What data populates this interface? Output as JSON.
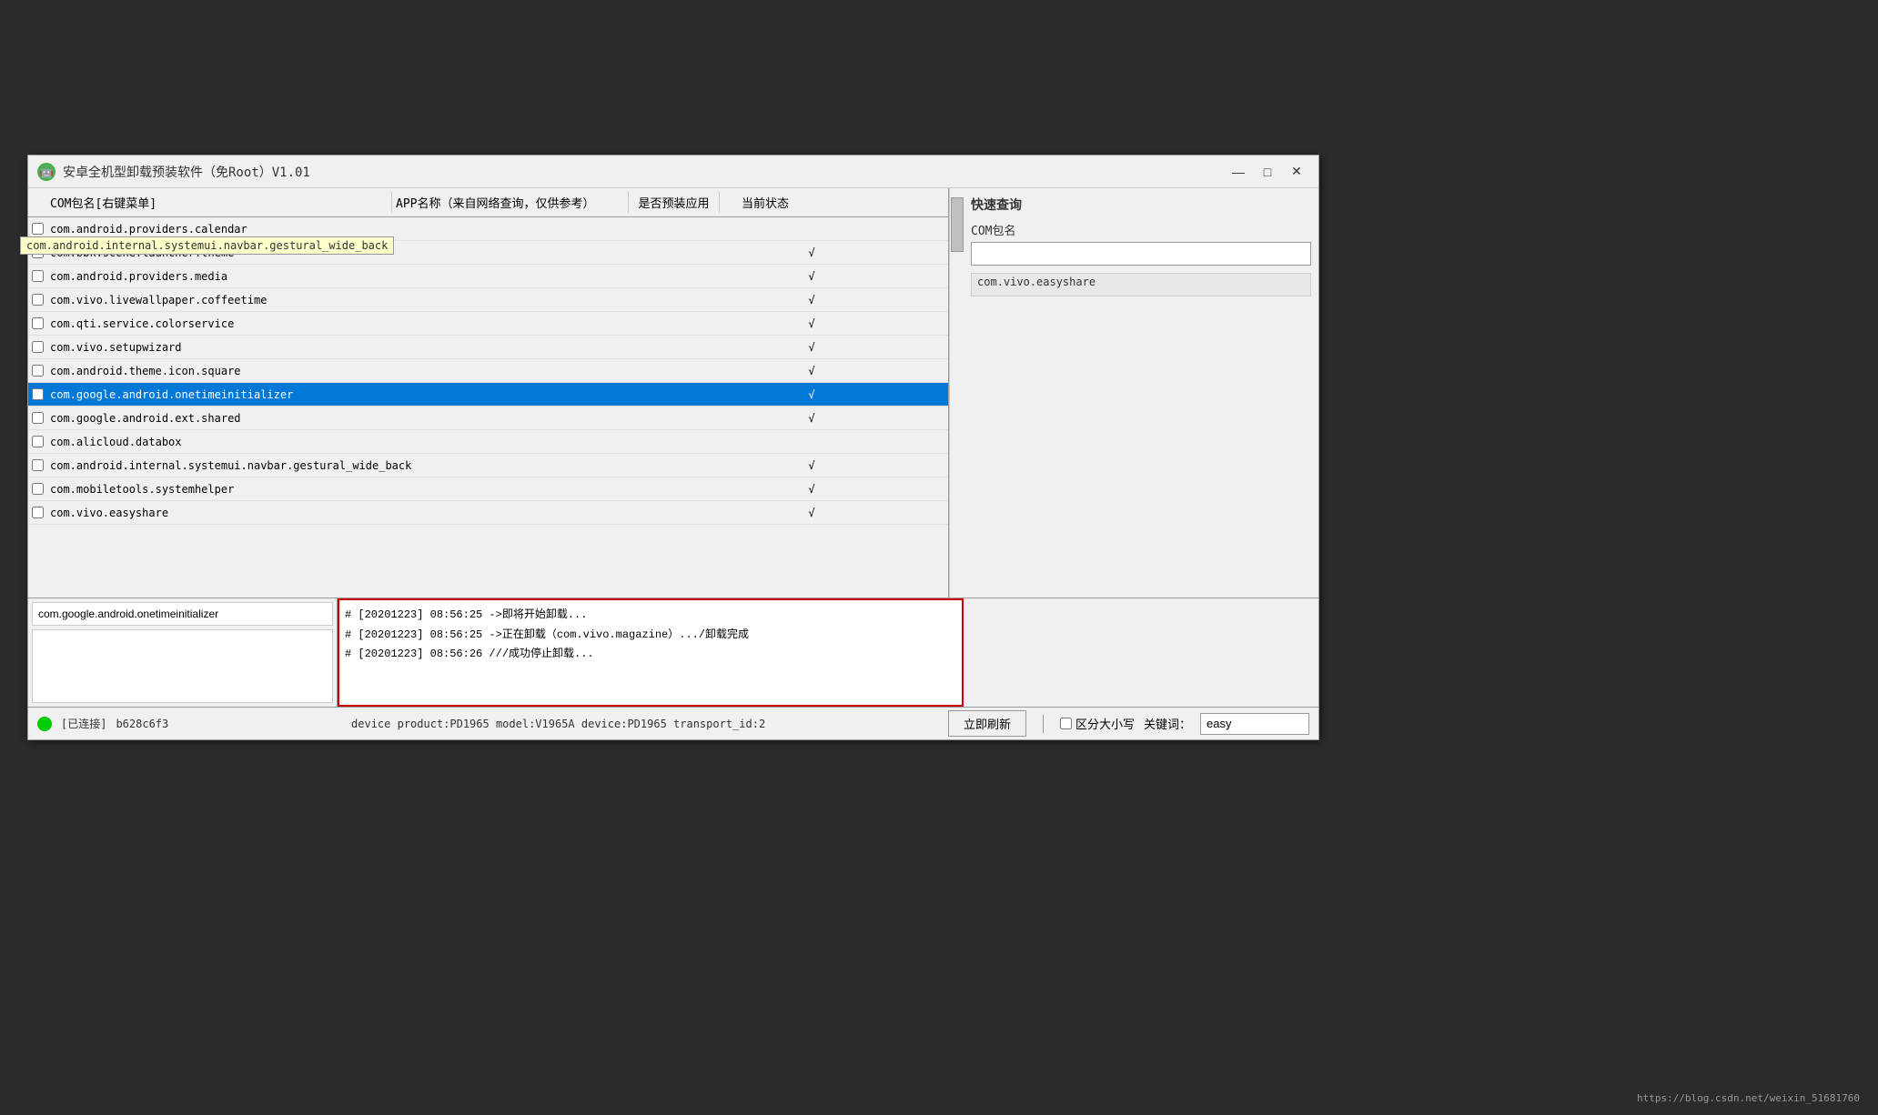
{
  "window": {
    "title": "安卓全机型卸载预装软件（免Root）V1.01",
    "icon": "🤖",
    "minimize_label": "—",
    "maximize_label": "□",
    "close_label": "✕"
  },
  "table": {
    "headers": {
      "package": "COM包名[右键菜单]",
      "appname": "APP名称（来自网络查询，仅供参考）",
      "preinstall": "是否预装应用",
      "status": "当前状态"
    },
    "rows": [
      {
        "pkg": "com.android.providers.calendar",
        "name": "",
        "preinstall": "",
        "status": ""
      },
      {
        "pkg": "com.bbk.scene.launcher.theme",
        "name": "",
        "preinstall": "√",
        "status": ""
      },
      {
        "pkg": "com.android.providers.media",
        "name": "",
        "preinstall": "√",
        "status": ""
      },
      {
        "pkg": "com.vivo.livewallpaper.coffeetime",
        "name": "",
        "preinstall": "√",
        "status": ""
      },
      {
        "pkg": "com.qti.service.colorservice",
        "name": "",
        "preinstall": "√",
        "status": ""
      },
      {
        "pkg": "com.vivo.setupwizard",
        "name": "",
        "preinstall": "√",
        "status": ""
      },
      {
        "pkg": "com.android.theme.icon.square",
        "name": "",
        "preinstall": "√",
        "status": ""
      },
      {
        "pkg": "com.google.android.onetimeinitializer",
        "name": "",
        "preinstall": "√",
        "status": "",
        "selected": true
      },
      {
        "pkg": "com.google.android.ext.shared",
        "name": "",
        "preinstall": "√",
        "status": ""
      },
      {
        "pkg": "com.alicloud.databox",
        "name": "",
        "preinstall": "",
        "status": ""
      },
      {
        "pkg": "com.android.internal.systemui.navbar.gestural_wide_back",
        "name": "",
        "preinstall": "√",
        "status": ""
      },
      {
        "pkg": "com.mobiletools.systemhelper",
        "name": "",
        "preinstall": "√",
        "status": ""
      },
      {
        "pkg": "com.vivo.easyshare",
        "name": "",
        "preinstall": "√",
        "status": ""
      }
    ]
  },
  "quick_search": {
    "title": "快速查询",
    "package_label": "COM包名",
    "result_value": "com.vivo.easyshare"
  },
  "bottom": {
    "selected_pkg": "com.google.android.onetimeinitializer",
    "log_lines": [
      "# [20201223] 08:56:25 ->即将开始卸载...",
      "# [20201223] 08:56:25 ->正在卸载（com.vivo.magazine）.../卸载完成",
      "# [20201223] 08:56:26 ///成功停止卸载..."
    ]
  },
  "status_bar": {
    "connected_label": "[已连接]",
    "device_id": "b628c6f3",
    "device_info": "device product:PD1965 model:V1965A device:PD1965 transport_id:2",
    "refresh_label": "立即刷新",
    "case_sensitive_label": "区分大小写",
    "keyword_label": "关键词：",
    "keyword_value": "easy"
  },
  "tooltip": {
    "text": "com.android.internal.systemui.navbar.gestural_wide_back"
  },
  "watermark": {
    "text": "https://blog.csdn.net/weixin_51681760"
  }
}
